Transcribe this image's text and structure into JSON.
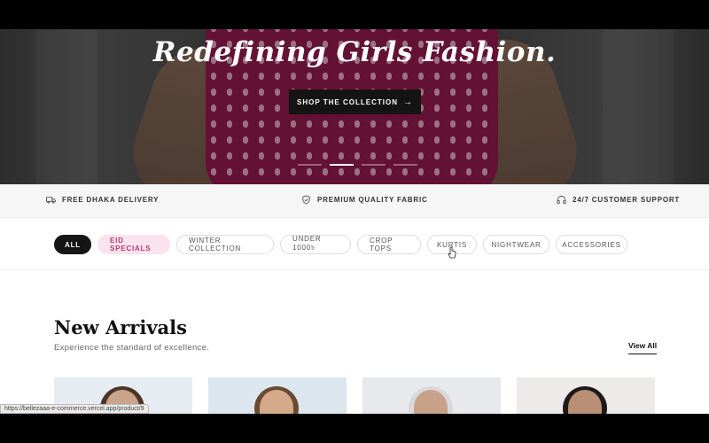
{
  "hero": {
    "title": "Redefining Girls Fashion.",
    "cta_label": "SHOP THE COLLECTION",
    "cta_icon": "arrow-right-icon",
    "slides": [
      {
        "active": false
      },
      {
        "active": true
      },
      {
        "active": false
      },
      {
        "active": false
      }
    ]
  },
  "features": [
    {
      "icon": "truck-icon",
      "label": "FREE DHAKA DELIVERY"
    },
    {
      "icon": "shield-check-icon",
      "label": "PREMIUM QUALITY FABRIC"
    },
    {
      "icon": "headphones-icon",
      "label": "24/7 CUSTOMER SUPPORT"
    }
  ],
  "filters": {
    "chips": [
      "ALL",
      "EID SPECIALS",
      "WINTER COLLECTION",
      "UNDER 1000৳",
      "CROP TOPS",
      "KURTIS",
      "NIGHTWEAR",
      "ACCESSORIES"
    ],
    "selected": "ALL",
    "highlighted": "EID SPECIALS"
  },
  "new_arrivals": {
    "title": "New Arrivals",
    "subtitle": "Experience the standard of excellence.",
    "view_all_label": "View All"
  },
  "status_bar": {
    "url": "https://bellezaaa-e-commerce.vercel.app/product/9"
  },
  "colors": {
    "accent_dark": "#151515",
    "accent_pink_bg": "#fbe3ee",
    "accent_pink_text": "#b53a73"
  }
}
